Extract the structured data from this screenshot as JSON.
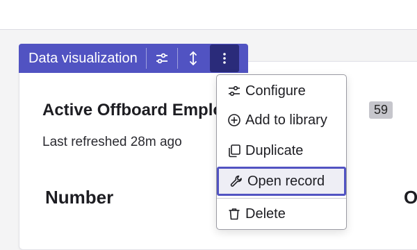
{
  "toolbar": {
    "label": "Data visualization",
    "configure_icon": "sliders-icon",
    "resize_icon": "vertical-arrows-icon",
    "more_icon": "vertical-ellipsis-icon",
    "accent": "#5153c2"
  },
  "card": {
    "title": "Active Offboard Employee Requests",
    "count": "59",
    "subtitle": "Last refreshed 28m ago",
    "columns": [
      "Number",
      "O"
    ]
  },
  "menu": {
    "items": [
      {
        "label": "Configure",
        "icon": "sliders-icon"
      },
      {
        "label": "Add to library",
        "icon": "plus-circle-icon"
      },
      {
        "label": "Duplicate",
        "icon": "copy-icon"
      },
      {
        "label": "Open record",
        "icon": "wrench-icon"
      },
      {
        "label": "Delete",
        "icon": "trash-icon"
      }
    ]
  }
}
